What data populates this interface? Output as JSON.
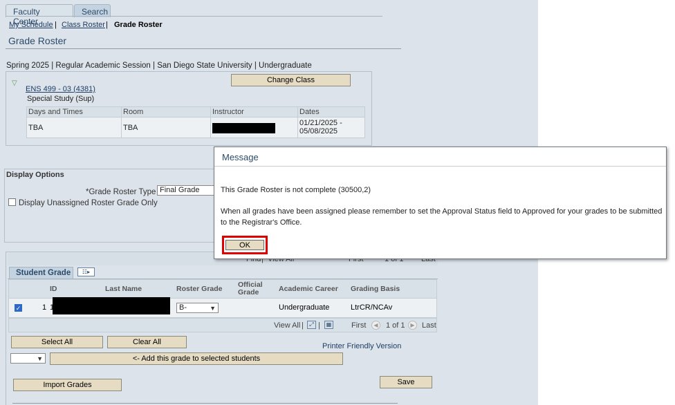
{
  "tabs": [
    "Faculty Center",
    "Search"
  ],
  "breadcrumbs": {
    "my_schedule": "My Schedule",
    "class_roster": "Class Roster",
    "grade_roster": "Grade Roster",
    "sep": "|"
  },
  "page_title": "Grade Roster",
  "term_line": "Spring 2025 | Regular Academic Session | San Diego State University | Undergraduate",
  "class": {
    "change_class_label": "Change Class",
    "course_link": "ENS 499 - 03 (4381)",
    "course_desc": "Special Study (Sup)",
    "headers": [
      "Days and Times",
      "Room",
      "Instructor",
      "Dates"
    ],
    "row": {
      "days_times": "TBA",
      "room": "TBA",
      "dates_line1": "01/21/2025 -",
      "dates_line2": "05/08/2025"
    }
  },
  "display_options": {
    "title": "Display Options",
    "grade_roster_type_label": "*Grade Roster Type",
    "grade_roster_type_value": "Final Grade",
    "unassigned_label": "Display Unassigned Roster Grade Only"
  },
  "roster": {
    "top_nav": {
      "find": "Find",
      "view_all": "View All",
      "first": "First",
      "range": "1 of 1",
      "last": "Last",
      "sep": "|"
    },
    "tab_label": "Student Grade",
    "headers": {
      "id": "ID",
      "last_name": "Last Name",
      "roster_grade": "Roster Grade",
      "official_grade_1": "Official",
      "official_grade_2": "Grade",
      "career": "Academic Career",
      "basis": "Grading Basis"
    },
    "row": {
      "num": "1",
      "id_prefix": "1",
      "roster_grade": "B-",
      "career": "Undergraduate",
      "basis": "LtrCR/NCAv"
    },
    "bottom_nav": {
      "view_all": "View All",
      "first": "First",
      "range": "1 of 1",
      "last": "Last",
      "sep": "|"
    }
  },
  "actions": {
    "select_all": "Select All",
    "clear_all": "Clear All",
    "printer_friendly": "Printer Friendly Version",
    "add_grade": "<- Add this grade to selected students",
    "import_grades": "Import Grades",
    "save": "Save"
  },
  "message": {
    "title": "Message",
    "line1": "This Grade Roster is not complete (30500,2)",
    "line2": "When all grades have been assigned please remember to set the Approval Status field to Approved for your grades to be submitted to the Registrar's Office.",
    "ok": "OK"
  },
  "colors": {
    "page_bg": "#dce3ea",
    "link": "#1e3d64",
    "button_bg": "#e6dcc4",
    "highlight": "#e00000"
  },
  "icons": [
    "expand-triangle-icon",
    "grid-options-icon",
    "zoom-icon",
    "download-icon",
    "prev-arrow-icon",
    "next-arrow-icon",
    "checkmark-icon",
    "chevron-down-icon"
  ]
}
